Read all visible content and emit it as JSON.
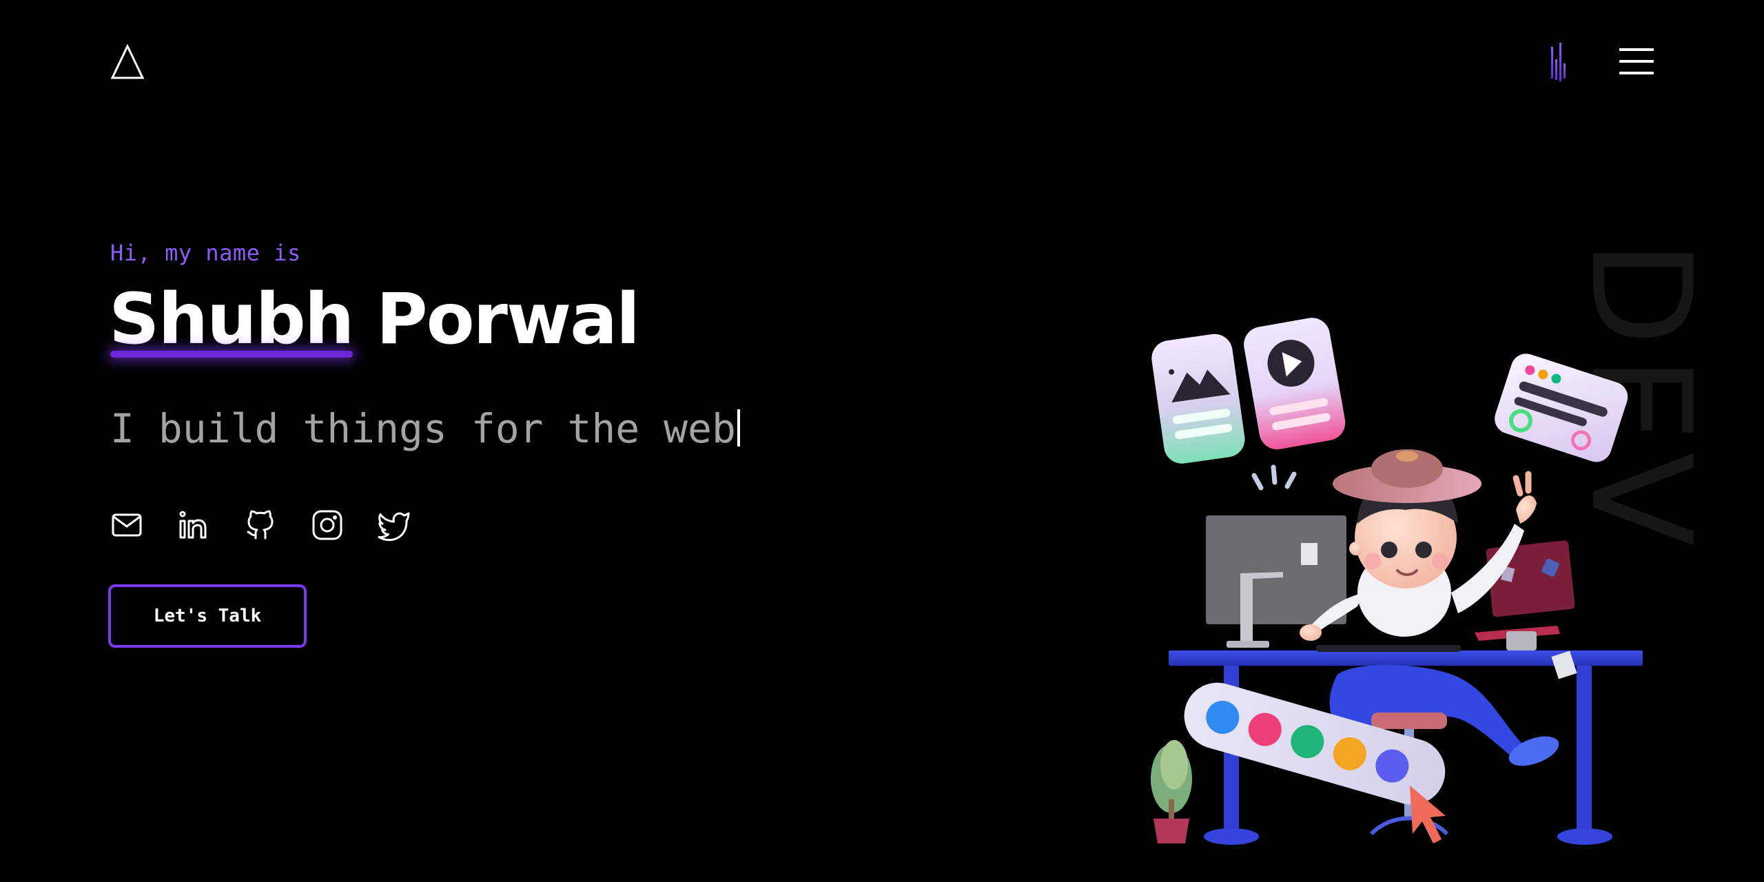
{
  "header": {
    "logo_icon": "triangle-logo-icon",
    "sound_icon": "sound-bars-icon",
    "menu_icon": "hamburger-menu-icon"
  },
  "hero": {
    "greeting": "Hi, my name is",
    "first_name": "Shubh",
    "last_name": "Porwal",
    "tagline": "I build things for the web",
    "cta_label": "Let's Talk",
    "watermark": "DEV"
  },
  "socials": [
    {
      "name": "mail-icon"
    },
    {
      "name": "linkedin-icon"
    },
    {
      "name": "github-icon"
    },
    {
      "name": "instagram-icon"
    },
    {
      "name": "twitter-icon"
    }
  ],
  "colors": {
    "background": "#000000",
    "accent": "#7c3aed",
    "accent_text": "#8b5cf6",
    "tagline": "#a3a3a3",
    "text": "#ffffff"
  }
}
